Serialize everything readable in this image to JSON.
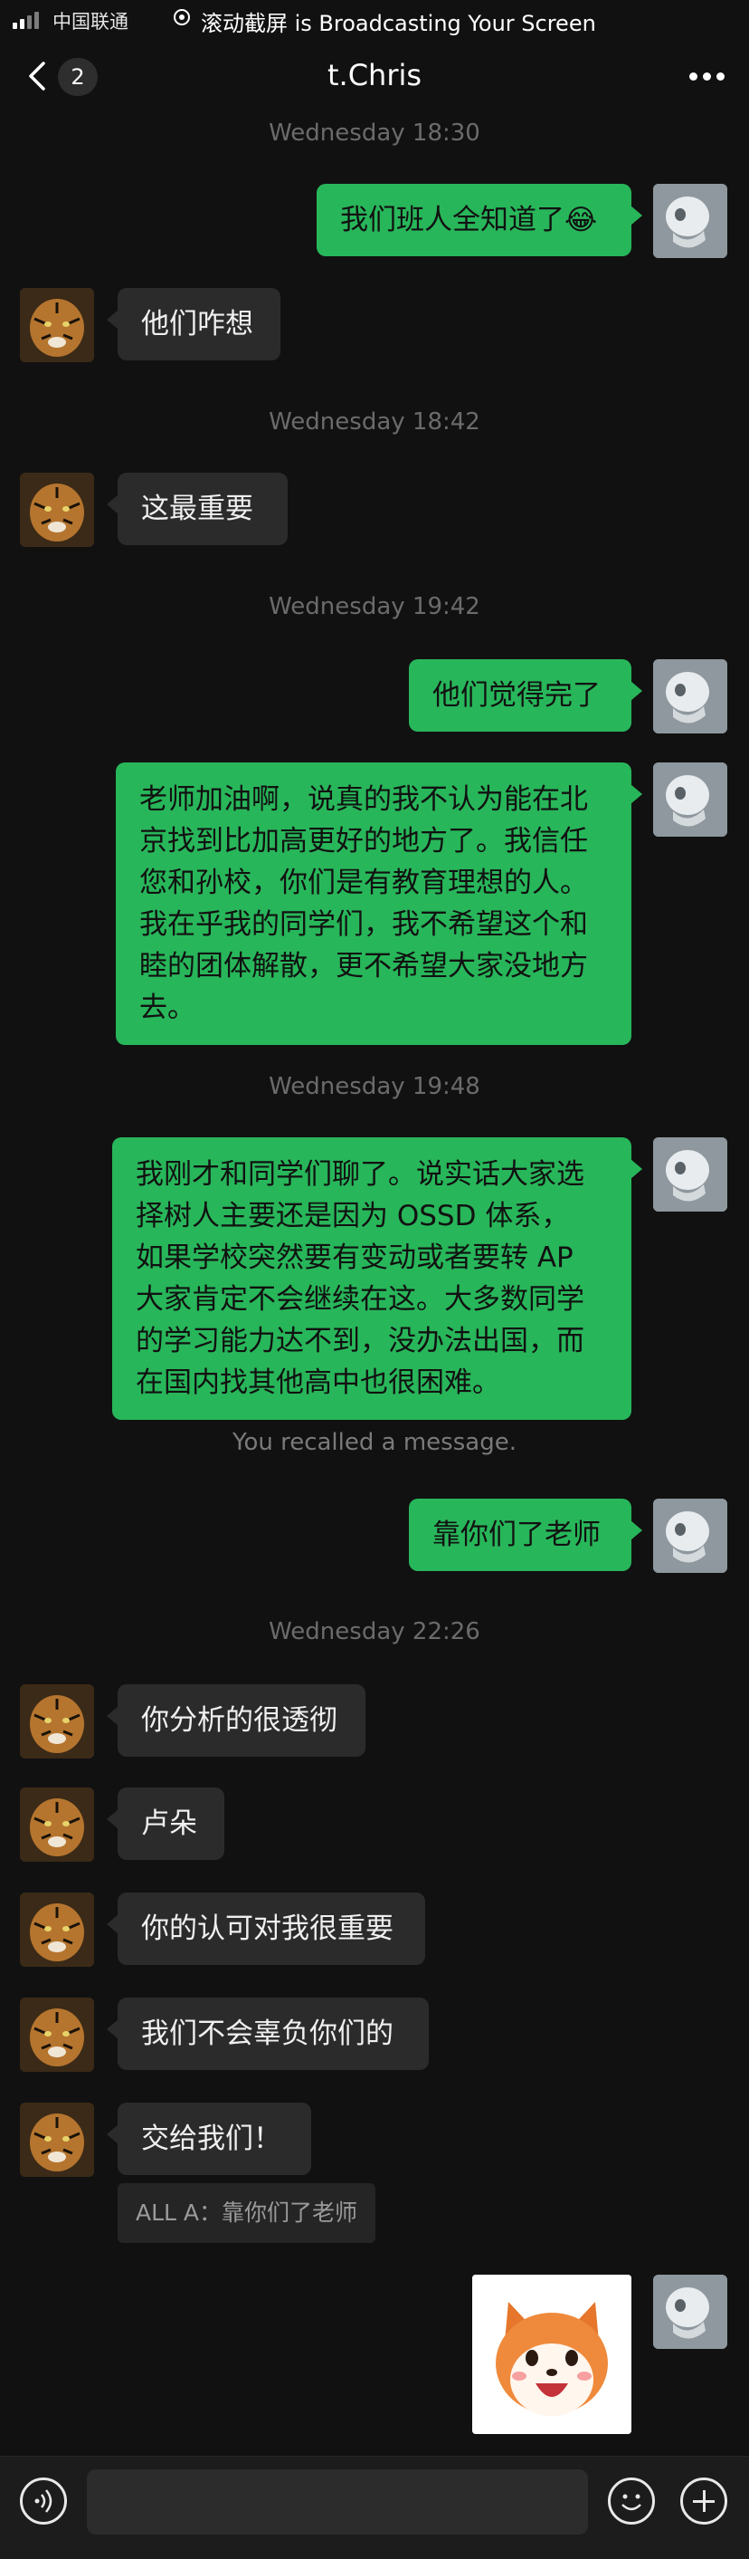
{
  "status_bar": {
    "carrier": "中国联通",
    "broadcast": "滚动截屏 is Broadcasting Your Screen"
  },
  "nav": {
    "back_count": "2",
    "title": "t.Chris"
  },
  "timestamps": [
    "Wednesday 18:30",
    "Wednesday 18:42",
    "Wednesday 19:42",
    "Wednesday 19:48",
    "Wednesday 22:26"
  ],
  "messages": [
    {
      "sender": "me",
      "text": "我们班人全知道了😂"
    },
    {
      "sender": "contact",
      "text": "他们咋想"
    },
    {
      "sender": "contact",
      "text": "这最重要"
    },
    {
      "sender": "me",
      "text": "他们觉得完了"
    },
    {
      "sender": "me",
      "lines": [
        "老师加油啊，说真的我不认为能在北",
        "京找到比加高更好的地方了。我信任",
        "您和孙校，你们是有教育理想的人。",
        "我在乎我的同学们，我不希望这个和",
        "睦的团体解散，更不希望大家没地方",
        "去。"
      ]
    },
    {
      "sender": "me",
      "lines": [
        "我刚才和同学们聊了。说实话大家选",
        "择树人主要还是因为 OSSD 体系，",
        "如果学校突然要有变动或者要转 AP",
        "大家肯定不会继续在这。大多数同学",
        "的学习能力达不到，没办法出国，而",
        "在国内找其他高中也很困难。"
      ]
    },
    {
      "sender": "me",
      "text": "靠你们了老师"
    },
    {
      "sender": "contact",
      "text": "你分析的很透彻"
    },
    {
      "sender": "contact",
      "text": "卢朵"
    },
    {
      "sender": "contact",
      "text": "你的认可对我很重要"
    },
    {
      "sender": "contact",
      "text": "我们不会辜负你们的"
    },
    {
      "sender": "contact",
      "text": "交给我们！"
    }
  ],
  "system": {
    "recalled": "You recalled a message."
  },
  "quote": "ALL A：靠你们了老师",
  "colors": {
    "background": "#111111",
    "my_bubble": "#28b65a",
    "their_bubble": "#2b2b2b"
  }
}
